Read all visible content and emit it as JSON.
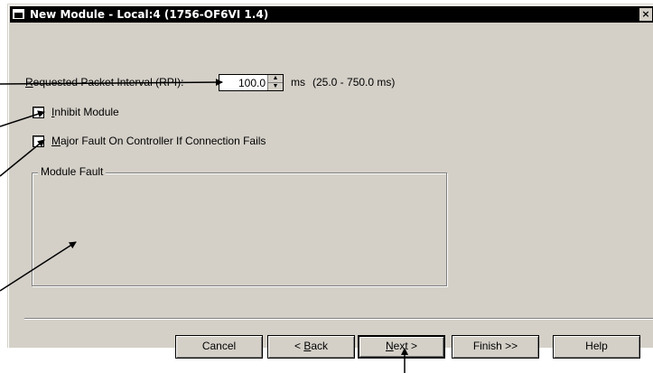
{
  "window": {
    "title": "New Module - Local:4 (1756-OF6VI 1.4)",
    "close_glyph": "×"
  },
  "rpi": {
    "label_prefix": "",
    "label_accel": "R",
    "label_rest": "equested Packet Interval (RPI):",
    "value": "100.0",
    "unit": "ms",
    "range": "(25.0 - 750.0 ms)"
  },
  "options": {
    "inhibit_accel": "I",
    "inhibit_rest": "nhibit Module",
    "inhibit_checked": false,
    "major_fault_accel": "M",
    "major_fault_rest": "ajor Fault On Controller If Connection Fails",
    "major_fault_checked": false
  },
  "module_fault": {
    "title": "Module Fault"
  },
  "buttons": {
    "cancel": "Cancel",
    "back_pre": "< ",
    "back_accel": "B",
    "back_rest": "ack",
    "next_accel": "N",
    "next_rest": "ext >",
    "finish": "Finish >>",
    "help": "Help"
  },
  "icons": [
    "window-icon",
    "close-icon",
    "spin-up-icon",
    "spin-down-icon"
  ]
}
